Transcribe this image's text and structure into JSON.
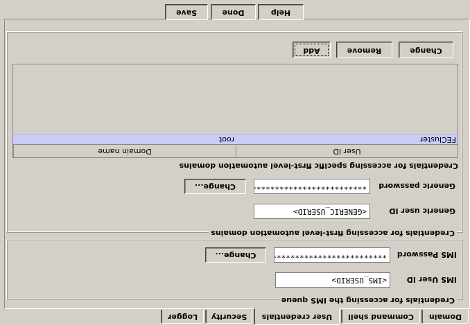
{
  "tabs": [
    {
      "label": "Domain",
      "active": false
    },
    {
      "label": "Command shell",
      "active": false
    },
    {
      "label": "User credentials",
      "active": true
    },
    {
      "label": "Security",
      "active": false
    },
    {
      "label": "Logger",
      "active": false
    }
  ],
  "ims_group": {
    "legend": "Credentials for accessing the IMS queue",
    "user_id_label": "IMS User ID",
    "user_id_value": "<IMS_USERID>",
    "password_label": "IMS Password",
    "password_value": "****************************",
    "change_label": "Change..."
  },
  "fla_group": {
    "legend": "Credentials for accessing first-level automation domains",
    "user_id_label": "Generic user ID",
    "user_id_value": "<GENERIC_USERID>",
    "password_label": "Generic password",
    "password_value": "****************************",
    "change_label": "Change..."
  },
  "specific_group": {
    "legend": "Credentials for accessing specific first-level automation domains",
    "columns": [
      "Domain name",
      "User ID"
    ],
    "rows": [
      {
        "domain": "FECluster",
        "user": "root",
        "selected": true
      }
    ],
    "buttons": {
      "add": "Add",
      "remove": "Remove",
      "change": "Change"
    }
  },
  "footer": {
    "save": "Save",
    "done": "Done",
    "help": "Help"
  }
}
